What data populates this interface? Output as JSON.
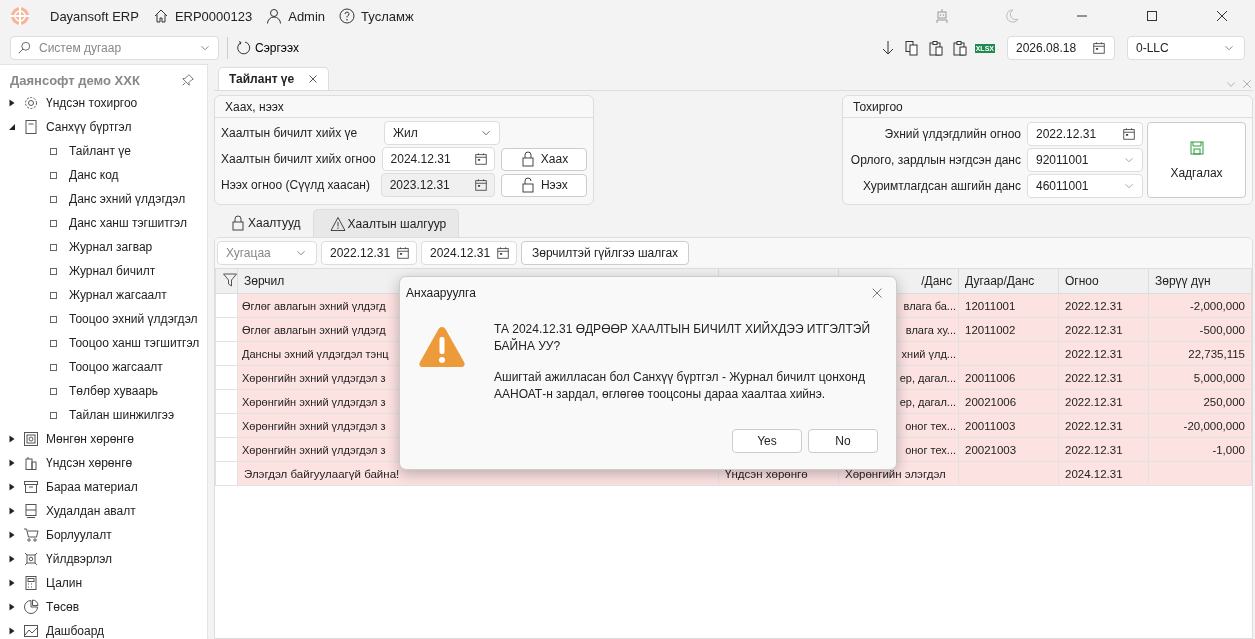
{
  "window": {
    "app_name": "Dayansoft ERP",
    "system_id": "ERP0000123",
    "user": "Admin",
    "help": "Тусламж"
  },
  "toolbar": {
    "search": {
      "placeholder": "Систем дугаар"
    },
    "refresh": "Сэргээх",
    "xlsx": "XLSX",
    "date": "2026.08.18",
    "company": "0-LLC"
  },
  "sidebar": {
    "title": "Даянсофт демо ХХК",
    "items": [
      {
        "label": "Үндсэн тохиргоо",
        "expanded": false
      },
      {
        "label": "Санхүү бүртгэл",
        "expanded": true,
        "children": [
          {
            "label": "Тайлант үе"
          },
          {
            "label": "Данс код"
          },
          {
            "label": "Данс эхний үлдэгдэл"
          },
          {
            "label": "Данс ханш тэгшитгэл"
          },
          {
            "label": "Журнал загвар"
          },
          {
            "label": "Журнал бичилт"
          },
          {
            "label": "Журнал жагсаалт"
          },
          {
            "label": "Тооцоо эхний үлдэгдэл"
          },
          {
            "label": "Тооцоо ханш тэгшитгэл"
          },
          {
            "label": "Тооцоо жагсаалт"
          },
          {
            "label": "Төлбөр хуваарь"
          },
          {
            "label": "Тайлан шинжилгээ"
          }
        ]
      },
      {
        "label": "Мөнгөн хөрөнгө",
        "expanded": false
      },
      {
        "label": "Үндсэн хөрөнгө",
        "expanded": false
      },
      {
        "label": "Бараа материал",
        "expanded": false
      },
      {
        "label": "Худалдан авалт",
        "expanded": false
      },
      {
        "label": "Борлуулалт",
        "expanded": false
      },
      {
        "label": "Үйлдвэрлэл",
        "expanded": false
      },
      {
        "label": "Цалин",
        "expanded": false
      },
      {
        "label": "Төсөв",
        "expanded": false
      },
      {
        "label": "Дашбоард",
        "expanded": false
      }
    ]
  },
  "doc_tabs": [
    {
      "label": "Тайлант үе",
      "selected": true
    }
  ],
  "close_panel": {
    "title": "Хаах, нээх",
    "rows": [
      {
        "label": "Хаалтын бичилт хийх үе",
        "kind": "select",
        "value": "Жил"
      },
      {
        "label": "Хаалтын бичилт хийх огноо",
        "kind": "date",
        "value": "2024.12.31",
        "button": "Хаах",
        "disabled": false
      },
      {
        "label": "Нээх огноо (Сүүлд хаасан)",
        "kind": "date",
        "value": "2023.12.31",
        "button": "Нээх",
        "disabled": true
      }
    ]
  },
  "settings_panel": {
    "title": "Тохиргоо",
    "rows": [
      {
        "label": "Эхний үлдэгдлийн огноо",
        "kind": "date",
        "value": "2022.12.31"
      },
      {
        "label": "Орлого, зардлын нэгдсэн данс",
        "kind": "select",
        "value": "92011001"
      },
      {
        "label": "Хуримтлагдсан ашгийн данс",
        "kind": "select",
        "value": "46011001"
      }
    ],
    "save": "Хадгалах"
  },
  "inner_tabs": [
    {
      "label": "Хаалтууд",
      "selected": false,
      "kind": "lock"
    },
    {
      "label": "Хаалтын шалгуур",
      "selected": true,
      "kind": "warning"
    }
  ],
  "filter": {
    "period": {
      "placeholder": "Хугацаа"
    },
    "from": "2022.12.31",
    "to": "2024.12.31",
    "check_button": "Зөрчилтэй гүйлгээ шалгах"
  },
  "table": {
    "columns": [
      {
        "label": "Зөрчил"
      },
      {},
      {
        "label": "/Данс"
      },
      {
        "label": "Дугаар/Данс"
      },
      {
        "label": "Огноо"
      },
      {
        "label": "Зөрүү дүн"
      }
    ],
    "rows": [
      {
        "covered": true,
        "cells": [
          "Өглөг авлагын эхний үлдэгд",
          "",
          "влага ба...",
          "12011001",
          "2022.12.31",
          "-2,000,000"
        ]
      },
      {
        "covered": true,
        "cells": [
          "Өглөг авлагын эхний үлдэгд",
          "",
          "влага ху...",
          "12011002",
          "2022.12.31",
          "-500,000"
        ]
      },
      {
        "covered": true,
        "cells": [
          "Дансны эхний үлдэгдэл тэнц",
          "",
          "хний үлд...",
          "",
          "2022.12.31",
          "22,735,115"
        ]
      },
      {
        "covered": true,
        "cells": [
          "Хөрөнгийн эхний үлдэгдэл з",
          "",
          "ер, дагал...",
          "20011006",
          "2022.12.31",
          "5,000,000"
        ]
      },
      {
        "covered": true,
        "cells": [
          "Хөрөнгийн эхний үлдэгдэл з",
          "",
          "ер, дагал...",
          "20021006",
          "2022.12.31",
          "250,000"
        ]
      },
      {
        "covered": true,
        "cells": [
          "Хөрөнгийн эхний үлдэгдэл з",
          "",
          "оног тех...",
          "20011003",
          "2022.12.31",
          "-20,000,000"
        ]
      },
      {
        "covered": true,
        "cells": [
          "Хөрөнгийн эхний үлдэгдэл з",
          "",
          "оног тех...",
          "20021003",
          "2022.12.31",
          "-1,000"
        ]
      },
      {
        "covered": false,
        "cells": [
          "Элэгдэл байгуулаагүй байна!",
          "Үндсэн хөрөнгө",
          "Хөрөнгийн элэгдэл",
          "",
          "2024.12.31",
          ""
        ]
      }
    ]
  },
  "dialog": {
    "title": "Анхааруулга",
    "message": "ТА 2024.12.31 ӨДРӨӨР ХААЛТЫН БИЧИЛТ ХИЙХДЭЭ ИТГЭЛТЭЙ БАЙНА УУ?",
    "note": "Ашигтай ажилласан бол Санхүү бүртгэл - Журнал бичилт цонхонд ААНОАТ-н зардал, өглөгөө тооцсоны дараа хаалтаа хийнэ.",
    "buttons": [
      "Yes",
      "No"
    ]
  }
}
